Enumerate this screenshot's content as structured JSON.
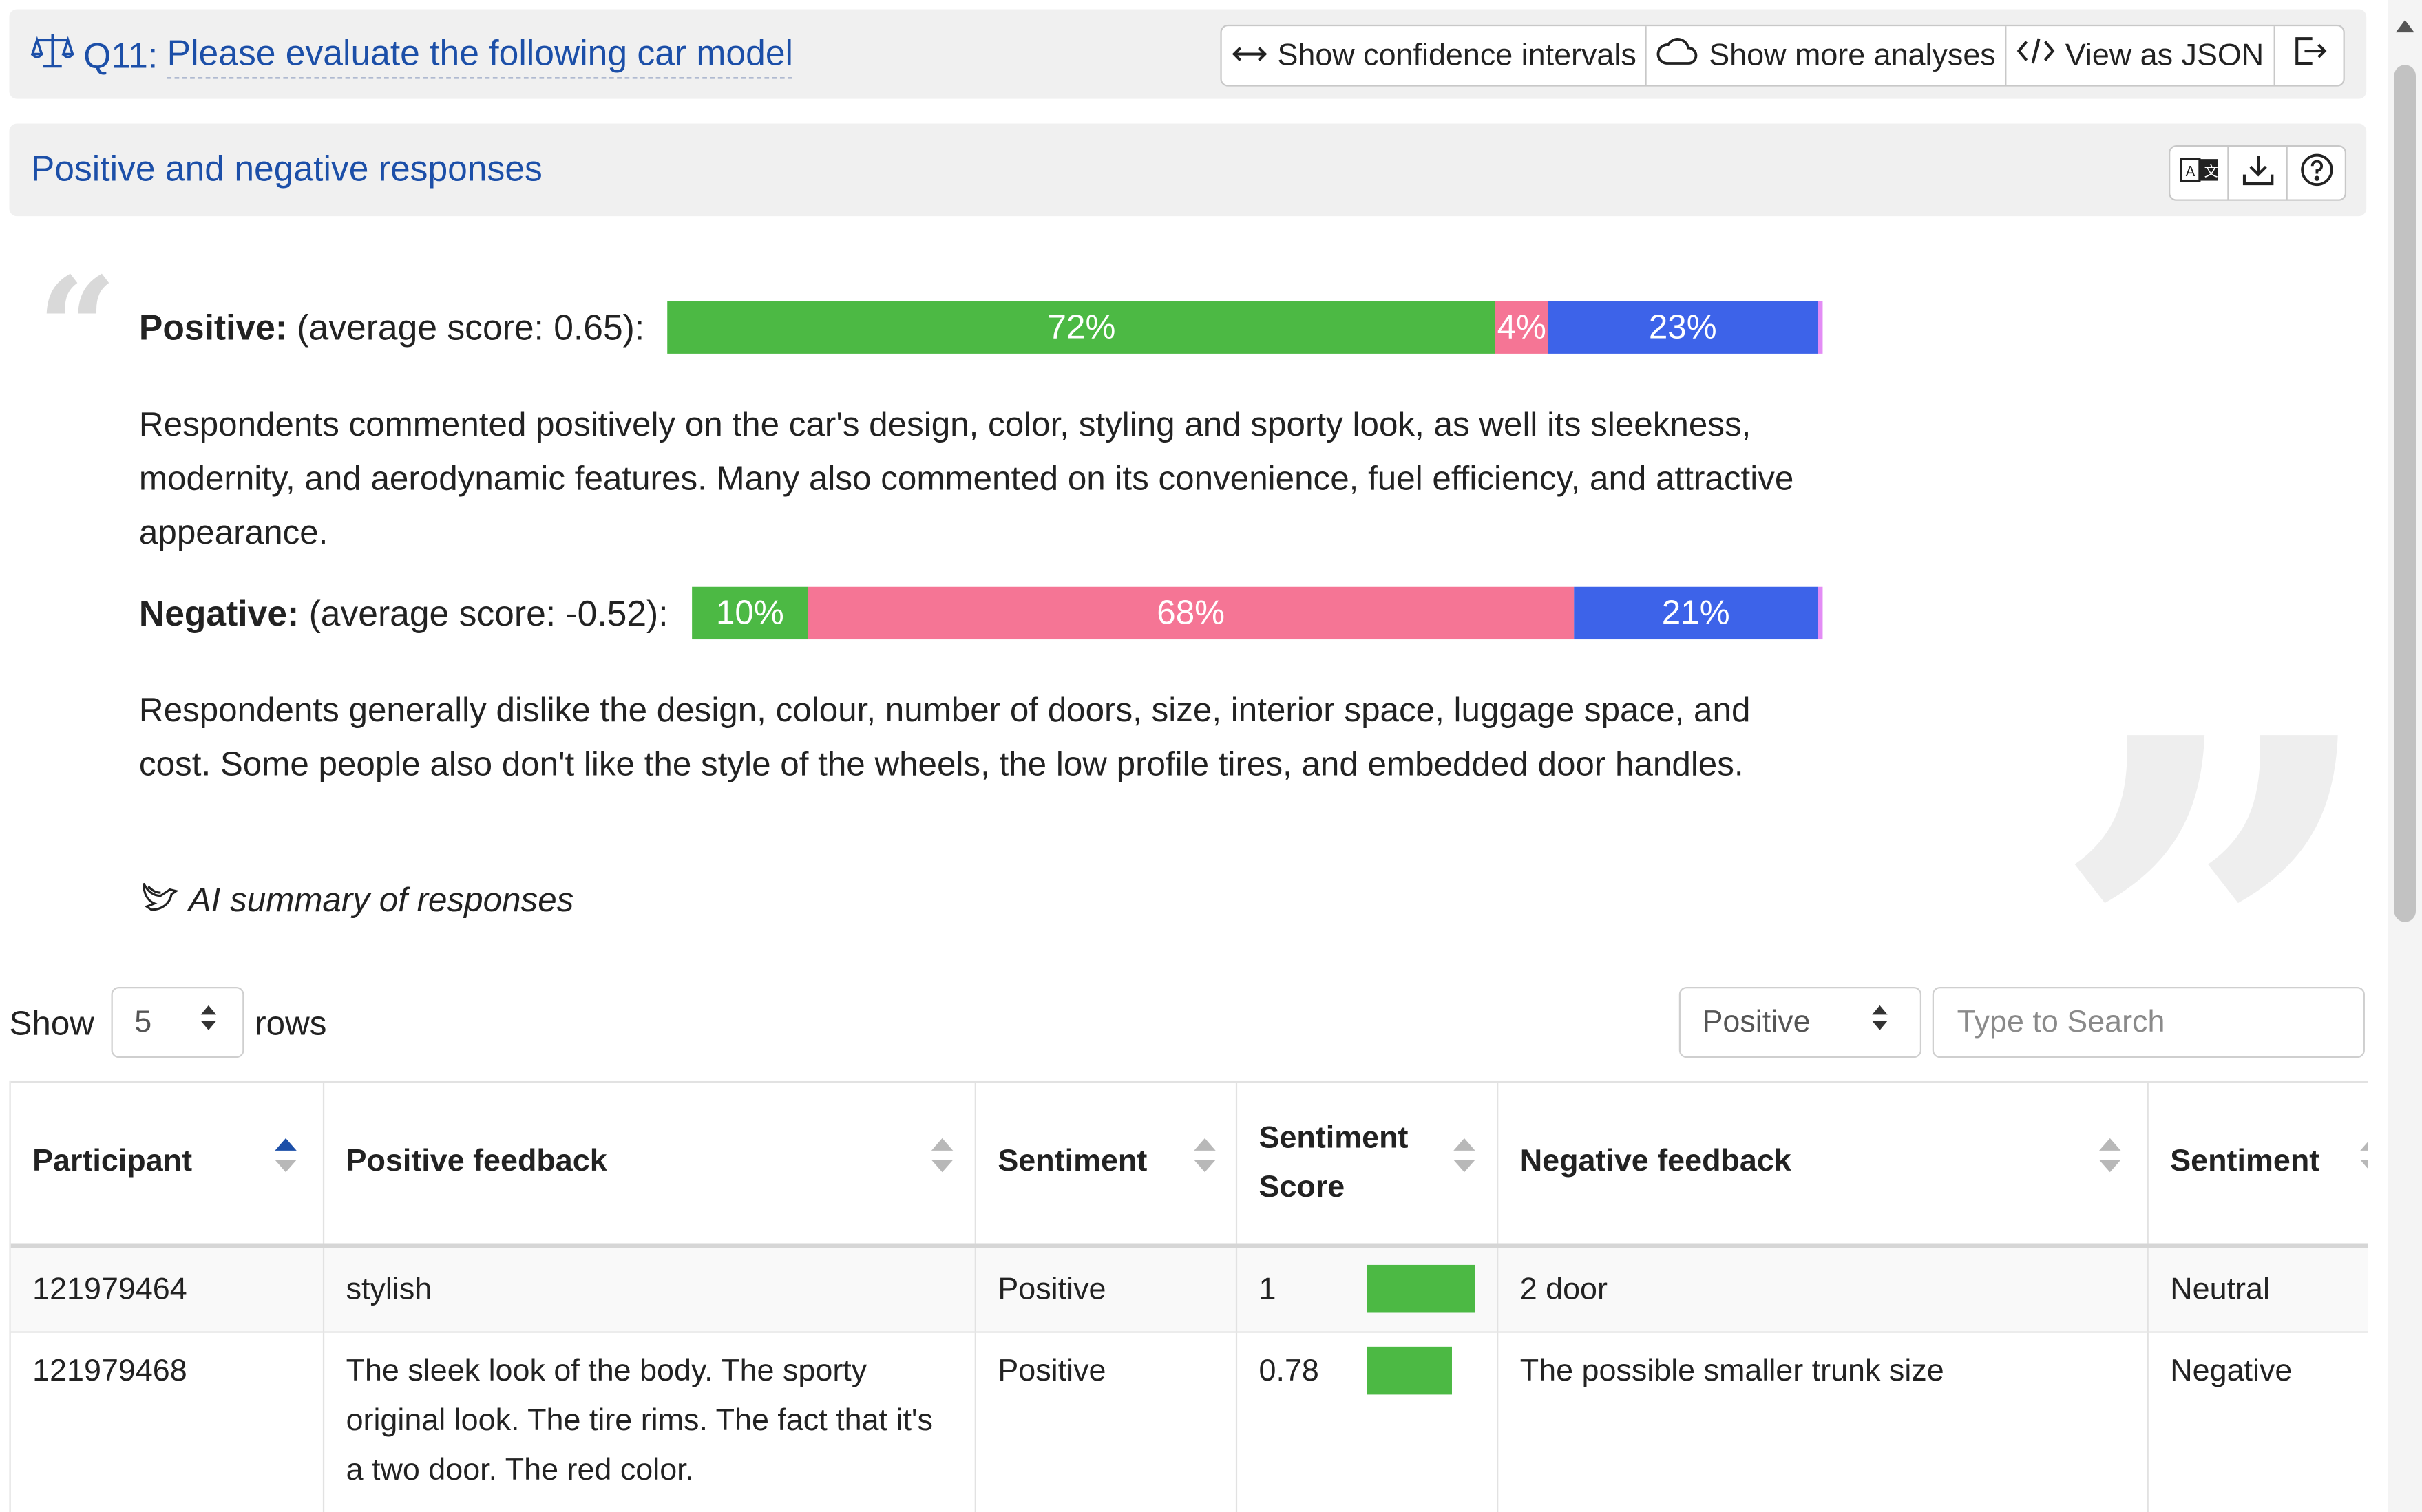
{
  "header": {
    "question_number": "Q11:",
    "question_text": "Please evaluate the following car model",
    "buttons": [
      "Show confidence intervals",
      "Show more analyses",
      "View as JSON"
    ]
  },
  "section": {
    "title": "Positive and negative responses"
  },
  "positive": {
    "label": "Positive:",
    "score_text": "(average score: 0.65):",
    "segments": [
      {
        "value": 72,
        "label": "72%",
        "color": "#4cb944"
      },
      {
        "value": 4.5,
        "label": "4%",
        "color": "#f57595"
      },
      {
        "value": 23.5,
        "label": "23%",
        "color": "#3d63e9"
      }
    ],
    "summary": "Respondents commented positively on the car's design, color, styling and sporty look, as well its sleekness, modernity, and aerodynamic features. Many also commented on its convenience, fuel efficiency, and attractive appearance."
  },
  "negative": {
    "label": "Negative:",
    "score_text": "(average score: -0.52):",
    "segments": [
      {
        "value": 10.3,
        "label": "10%",
        "color": "#4cb944"
      },
      {
        "value": 68,
        "label": "68%",
        "color": "#f57595"
      },
      {
        "value": 21.7,
        "label": "21%",
        "color": "#3d63e9"
      }
    ],
    "summary": "Respondents generally dislike the design, colour, number of doors, size, interior space, luggage space, and cost. Some people also don't like the style of the wheels, the low profile tires, and embedded door handles."
  },
  "ai_summary_label": "AI summary of responses",
  "controls": {
    "show_label": "Show",
    "rows_value": "5",
    "rows_label": "rows",
    "filter_value": "Positive",
    "search_placeholder": "Type to Search"
  },
  "table": {
    "columns": [
      "Participant",
      "Positive feedback",
      "Sentiment",
      "Sentiment Score",
      "Negative feedback",
      "Sentiment"
    ],
    "rows": [
      {
        "participant": "121979464",
        "positive_feedback": "stylish",
        "sentiment": "Positive",
        "score": "1",
        "score_value": 1,
        "negative_feedback": "2 door",
        "neg_sentiment": "Neutral"
      },
      {
        "participant": "121979468",
        "positive_feedback": "The sleek look of the body. The sporty original look. The tire rims. The fact that it's a two door. The red color.",
        "sentiment": "Positive",
        "score": "0.78",
        "score_value": 0.78,
        "negative_feedback": "The possible smaller trunk size",
        "neg_sentiment": "Negative"
      }
    ]
  },
  "colors": {
    "accent": "#1c4fa8",
    "positive": "#4cb944",
    "negative": "#f57595",
    "neutral": "#3d63e9"
  }
}
